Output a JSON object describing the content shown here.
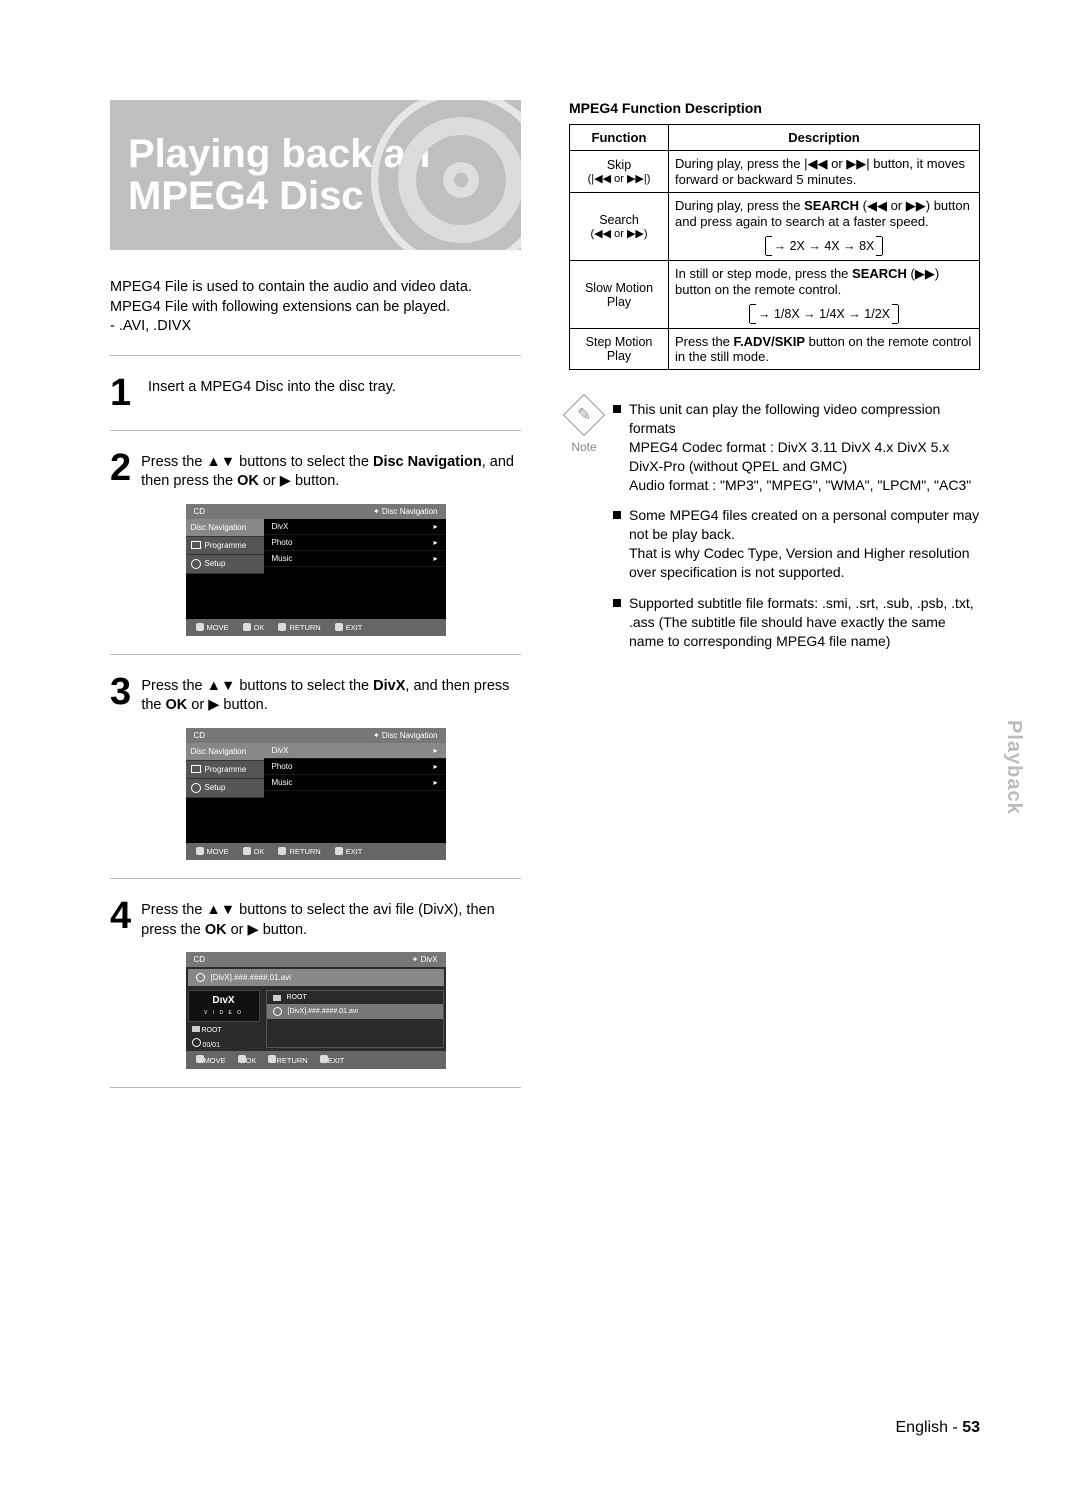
{
  "hero": {
    "line1": "Playing back an",
    "line2": "MPEG4 Disc"
  },
  "intro": {
    "p1": "MPEG4 File is used to contain the audio and video data.",
    "p2": "MPEG4 File with following extensions can be played.",
    "p3": "- .AVI, .DIVX"
  },
  "steps": {
    "s1": {
      "num": "1",
      "text": "Insert a MPEG4 Disc into the disc tray."
    },
    "s2": {
      "num": "2",
      "t1": "Press the ",
      "t_glyph": "▲▼",
      "t2": " buttons to select the ",
      "b1": "Disc Navigation",
      "t3": ", and then press the ",
      "b2": "OK",
      "t4": " or ",
      "g2": "▶",
      "t5": " button."
    },
    "s3": {
      "num": "3",
      "t1": "Press the ",
      "t_glyph": "▲▼",
      "t2": " buttons to select the ",
      "b1": "DivX",
      "t3": ", and then press the ",
      "b2": "OK",
      "t4": " or ",
      "g2": "▶",
      "t5": " button."
    },
    "s4": {
      "num": "4",
      "t1": "Press the ",
      "t_glyph": "▲▼",
      "t2": " buttons to select the avi file (DivX), then press the ",
      "b2": "OK",
      "t4": " or ",
      "g2": "▶",
      "t5": " button."
    }
  },
  "osdA": {
    "cd": "CD",
    "crumb": "✦ Disc Navigation",
    "side": {
      "a": "Disc Navigation",
      "b": "Programme",
      "c": "Setup"
    },
    "rows": {
      "a": "DivX",
      "b": "Photo",
      "c": "Music",
      "arrow": "▸"
    },
    "foot": {
      "move": "MOVE",
      "ok": "OK",
      "ret": "RETURN",
      "exit": "EXIT"
    }
  },
  "osdB": {
    "cd": "CD",
    "crumb": "✦ Disc Navigation",
    "side": {
      "a": "Disc Navigation",
      "b": "Programme",
      "c": "Setup"
    },
    "rows": {
      "a": "DivX",
      "b": "Photo",
      "c": "Music",
      "arrow": "▸"
    },
    "foot": {
      "move": "MOVE",
      "ok": "OK",
      "ret": "RETURN",
      "exit": "EXIT"
    }
  },
  "osdC": {
    "cd": "CD",
    "crumb": "✦ DivX",
    "file": "[DivX].###.####.01.avi",
    "logo": "DıvX",
    "logo_sub": "V I D E O",
    "root": "ROOT",
    "meta_root": "ROOT",
    "meta_count": "00/01",
    "foot": {
      "move": "MOVE",
      "ok": "OK",
      "ret": "RETURN",
      "exit": "EXIT"
    }
  },
  "right": {
    "heading": "MPEG4 Function Description",
    "th1": "Function",
    "th2": "Description",
    "skip": {
      "name": "Skip",
      "sub": "(|◀◀ or ▶▶|)",
      "d1": "During play, press the ",
      "g1": "|◀◀",
      "d2": " or ",
      "g2": "▶▶|",
      "d3": " button, it moves forward or backward 5 minutes."
    },
    "search": {
      "name": "Search",
      "sub": "(◀◀ or ▶▶)",
      "d1": "During play, press the ",
      "b": "SEARCH",
      "d2": " (",
      "g1": "◀◀",
      "d3": " or ",
      "g2": "▶▶",
      "d4": ") button and press again to search at a faster speed.",
      "seq": "2X → 4X → 8X"
    },
    "slow": {
      "name1": "Slow Motion",
      "name2": "Play",
      "d1": "In still or step mode, press the ",
      "b": "SEARCH",
      "d2": " (",
      "g": "▶▶",
      "d3": ") button on the remote control.",
      "seq": "1/8X → 1/4X → 1/2X"
    },
    "stepm": {
      "name1": "Step Motion",
      "name2": "Play",
      "d1": "Press the ",
      "b": "F.ADV/SKIP",
      "d2": " button on the remote control in the still mode."
    }
  },
  "note": {
    "label": "Note",
    "n1a": "This unit can play the following video compression formats",
    "n1b": "MPEG4 Codec format : DivX 3.11 DivX 4.x DivX 5.x DivX-Pro (without QPEL and GMC)",
    "n1c": "Audio format : \"MP3\", \"MPEG\", \"WMA\", \"LPCM\", \"AC3\"",
    "n2a": "Some MPEG4 files created on a personal computer may not be play back.",
    "n2b": "That is why Codec Type, Version and Higher resolution over specification is not supported.",
    "n3": "Supported subtitle file formats: .smi, .srt, .sub, .psb, .txt, .ass (The subtitle file should have exactly the same name to corresponding MPEG4 file name)"
  },
  "sidetab": "Playback",
  "footer": {
    "lang": "English",
    "sep": " - ",
    "page": "53"
  }
}
